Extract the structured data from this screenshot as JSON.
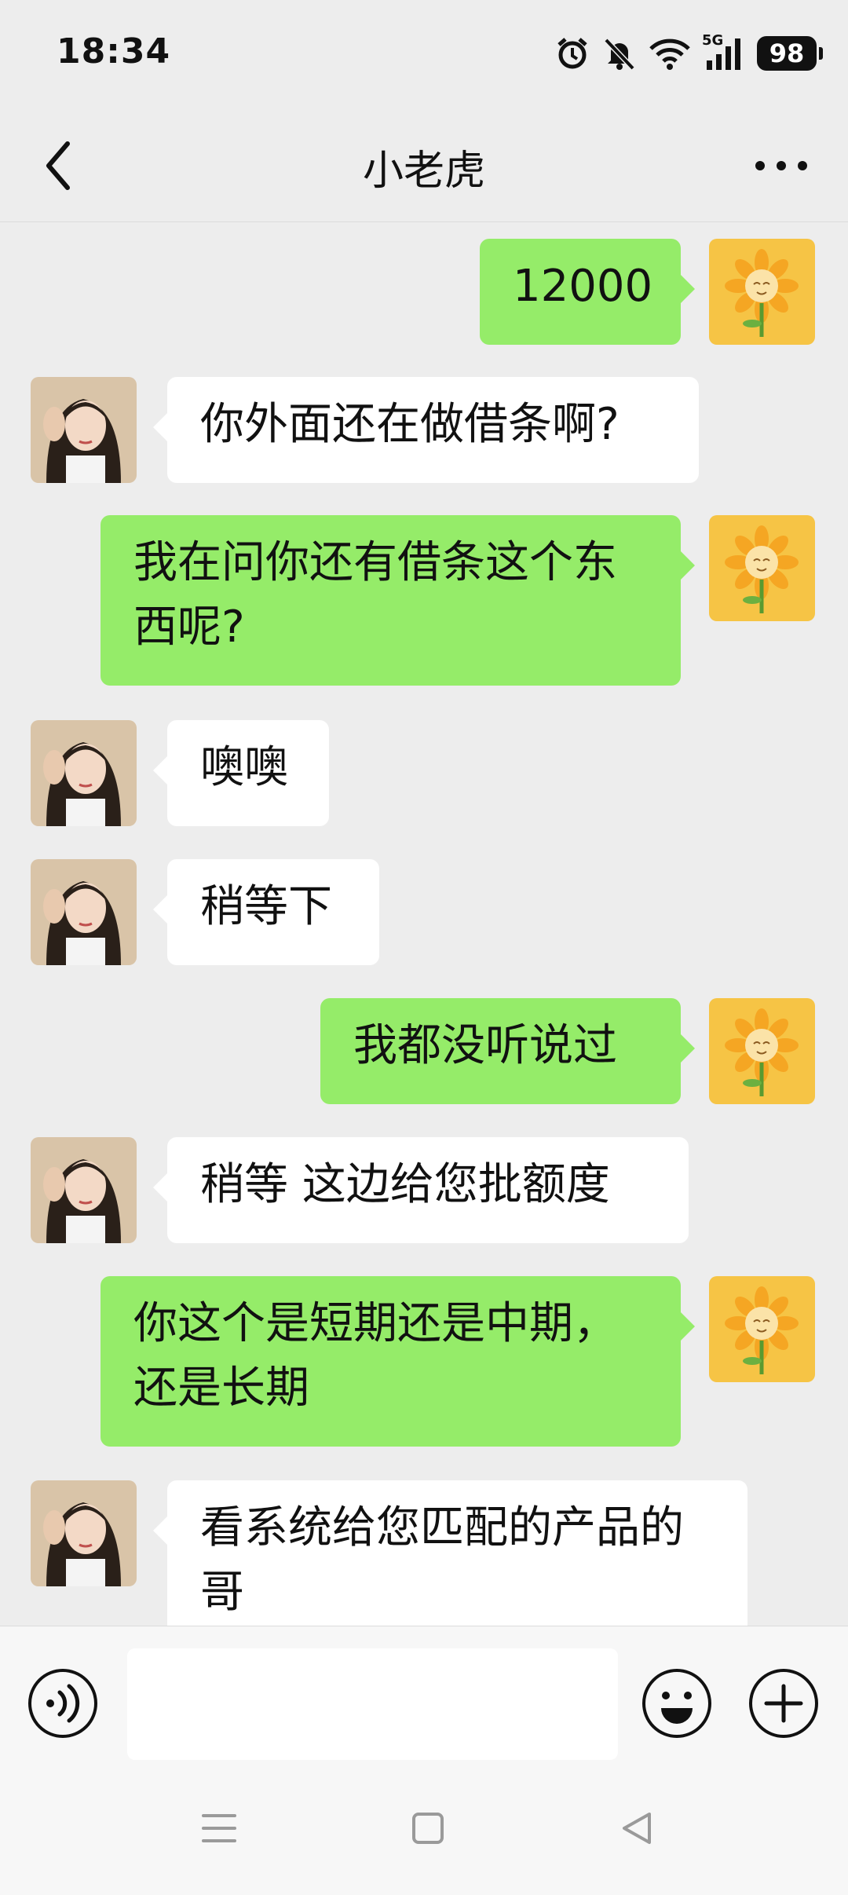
{
  "status_bar": {
    "time": "18:34",
    "network": "5G",
    "battery": "98",
    "icons": [
      "alarm-icon",
      "mute-icon",
      "wifi-icon",
      "signal-icon",
      "battery-icon"
    ]
  },
  "header": {
    "title": "小老虎",
    "back_icon": "chevron-left-icon",
    "more_icon": "more-dots-icon"
  },
  "messages": [
    {
      "from": "me",
      "text": "12000"
    },
    {
      "from": "other",
      "text": "你外面还在做借条啊?"
    },
    {
      "from": "me",
      "text": "我在问你还有借条这个东西呢?"
    },
    {
      "from": "other",
      "text": "噢噢"
    },
    {
      "from": "other",
      "text": "稍等下"
    },
    {
      "from": "me",
      "text": "我都没听说过"
    },
    {
      "from": "other",
      "text": "稍等 这边给您批额度"
    },
    {
      "from": "me",
      "text": "你这个是短期还是中期，还是长期"
    },
    {
      "from": "other",
      "text": "看系统给您匹配的产品的哥"
    }
  ],
  "composer": {
    "placeholder": "",
    "voice_icon": "voice-icon",
    "emoji_icon": "emoji-icon",
    "plus_icon": "plus-icon"
  },
  "colors": {
    "background": "#EDEDED",
    "my_bubble": "#95EC69",
    "other_bubble": "#FFFFFF"
  }
}
